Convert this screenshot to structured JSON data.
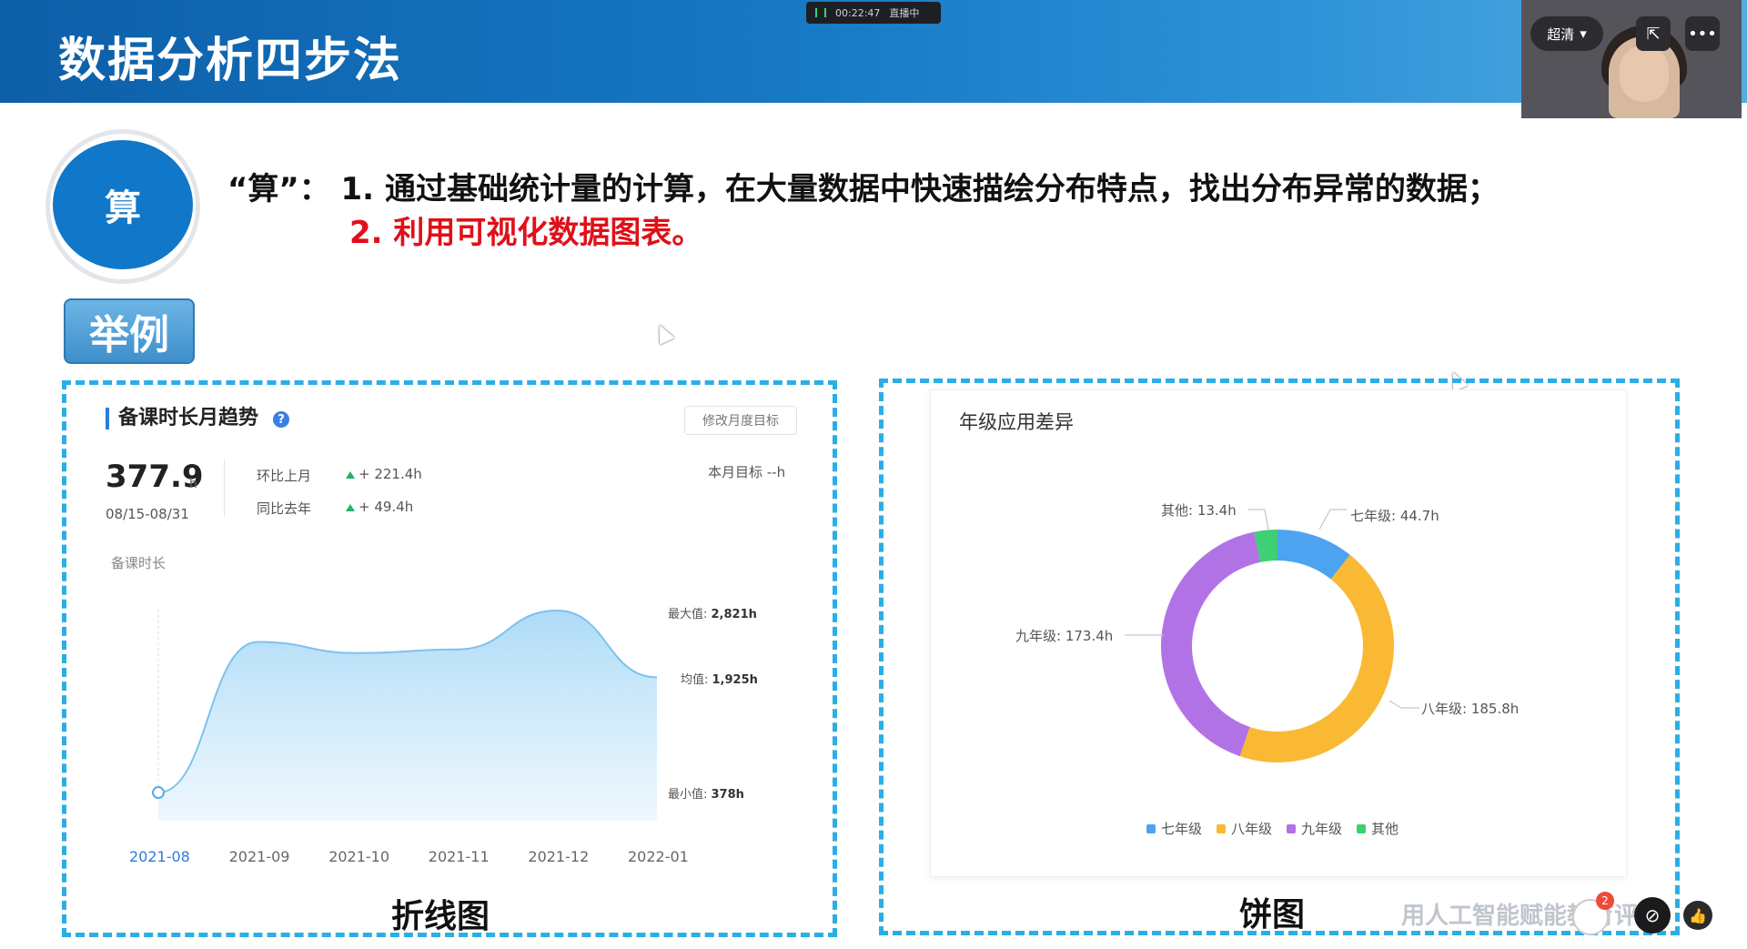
{
  "header": {
    "title": "数据分析四步法"
  },
  "status_bar": {
    "time": "00:22:47",
    "state": "直播中"
  },
  "video": {
    "quality_label": "超清",
    "share_icon": "share-icon",
    "more_icon": "more-icon"
  },
  "step": {
    "circle_label": "算",
    "line1": "“算”：  1. 通过基础统计量的计算，在大量数据中快速描绘分布特点，找出分布异常的数据；",
    "line2": "2. 利用可视化数据图表。",
    "example_tag": "举例"
  },
  "line_card": {
    "title": "备课时长月趋势",
    "help": "?",
    "modify_btn": "修改月度目标",
    "value": "377.9",
    "unit": "h",
    "date_range": "08/15-08/31",
    "mom_label": "环比上月",
    "mom_value": "+ 221.4h",
    "yoy_label": "同比去年",
    "yoy_value": "+ 49.4h",
    "target": "本月目标 --h",
    "y_label": "备课时长",
    "max_label": "最大值: ",
    "max_value": "2,821h",
    "avg_label": "均值: ",
    "avg_value": "1,925h",
    "min_label": "最小值: ",
    "min_value": "378h",
    "caption": "折线图"
  },
  "pie_card": {
    "title": "年级应用差异",
    "caption": "饼图",
    "labels": {
      "g7": "七年级: 44.7h",
      "g8": "八年级: 185.8h",
      "g9": "九年级: 173.4h",
      "other": "其他: 13.4h"
    },
    "legend": [
      "七年级",
      "八年级",
      "九年级",
      "其他"
    ]
  },
  "chart_data": [
    {
      "type": "area",
      "title": "备课时长月趋势",
      "ylabel": "备课时长",
      "categories": [
        "2021-08",
        "2021-09",
        "2021-10",
        "2021-11",
        "2021-12",
        "2022-01"
      ],
      "series": [
        {
          "values": [
            378,
            2400,
            2250,
            2300,
            2821,
            1925
          ]
        }
      ],
      "annotations": {
        "max": "2,821h",
        "mean": "1,925h",
        "min": "378h"
      },
      "ylim": [
        0,
        3200
      ],
      "color": "#9fd3f5"
    },
    {
      "type": "pie",
      "title": "年级应用差异",
      "categories": [
        "七年级",
        "八年级",
        "九年级",
        "其他"
      ],
      "values": [
        44.7,
        185.8,
        173.4,
        13.4
      ],
      "colors": [
        "#4da3f0",
        "#f9b934",
        "#b172e6",
        "#3fcf75"
      ],
      "legend_position": "bottom"
    }
  ],
  "footer": {
    "watermark": "用人工智能赋能教育评价"
  }
}
